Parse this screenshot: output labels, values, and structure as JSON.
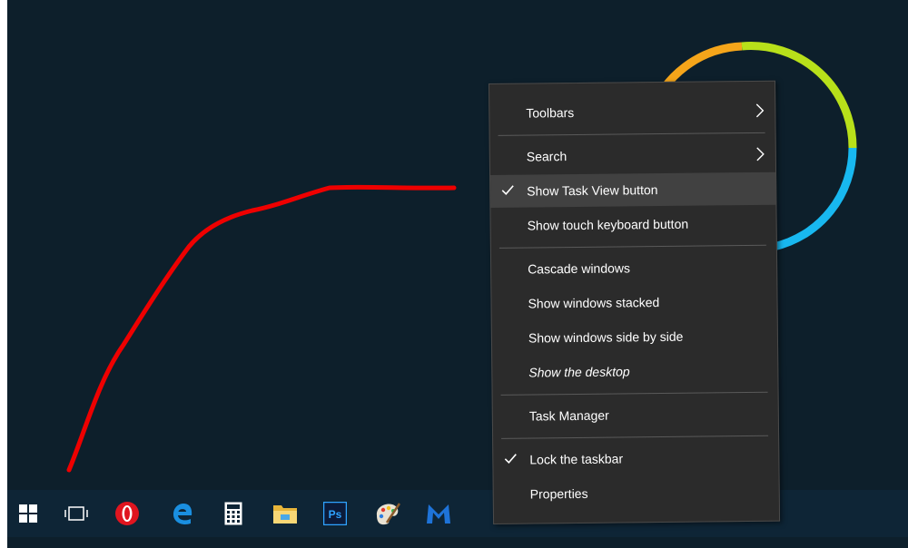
{
  "colors": {
    "desktop_bg": "#0d1f2b",
    "taskbar_bg": "#0e2536",
    "menu_bg": "#2b2b2b",
    "menu_highlight": "#414141",
    "menu_text": "#ffffff",
    "annotation": "#ee0000",
    "ring_segments": [
      "#f5a51a",
      "#b8e01a",
      "#18b8f0"
    ]
  },
  "context_menu": {
    "items": [
      {
        "label": "Toolbars",
        "submenu": true
      },
      {
        "label": "Search",
        "submenu": true
      },
      {
        "label": "Show Task View button",
        "checked": true,
        "highlighted": true
      },
      {
        "label": "Show touch keyboard button"
      },
      {
        "label": "Cascade windows"
      },
      {
        "label": "Show windows stacked"
      },
      {
        "label": "Show windows side by side"
      },
      {
        "label": "Show the desktop"
      },
      {
        "label": "Task Manager"
      },
      {
        "label": "Lock the taskbar",
        "checked": true
      },
      {
        "label": "Properties"
      }
    ]
  },
  "taskbar": {
    "icons": [
      "windows-start-icon",
      "task-view-icon",
      "opera-icon",
      "edge-icon",
      "calculator-icon",
      "file-explorer-icon",
      "photoshop-icon",
      "paint-icon",
      "malwarebytes-icon"
    ],
    "photoshop_label": "Ps"
  }
}
